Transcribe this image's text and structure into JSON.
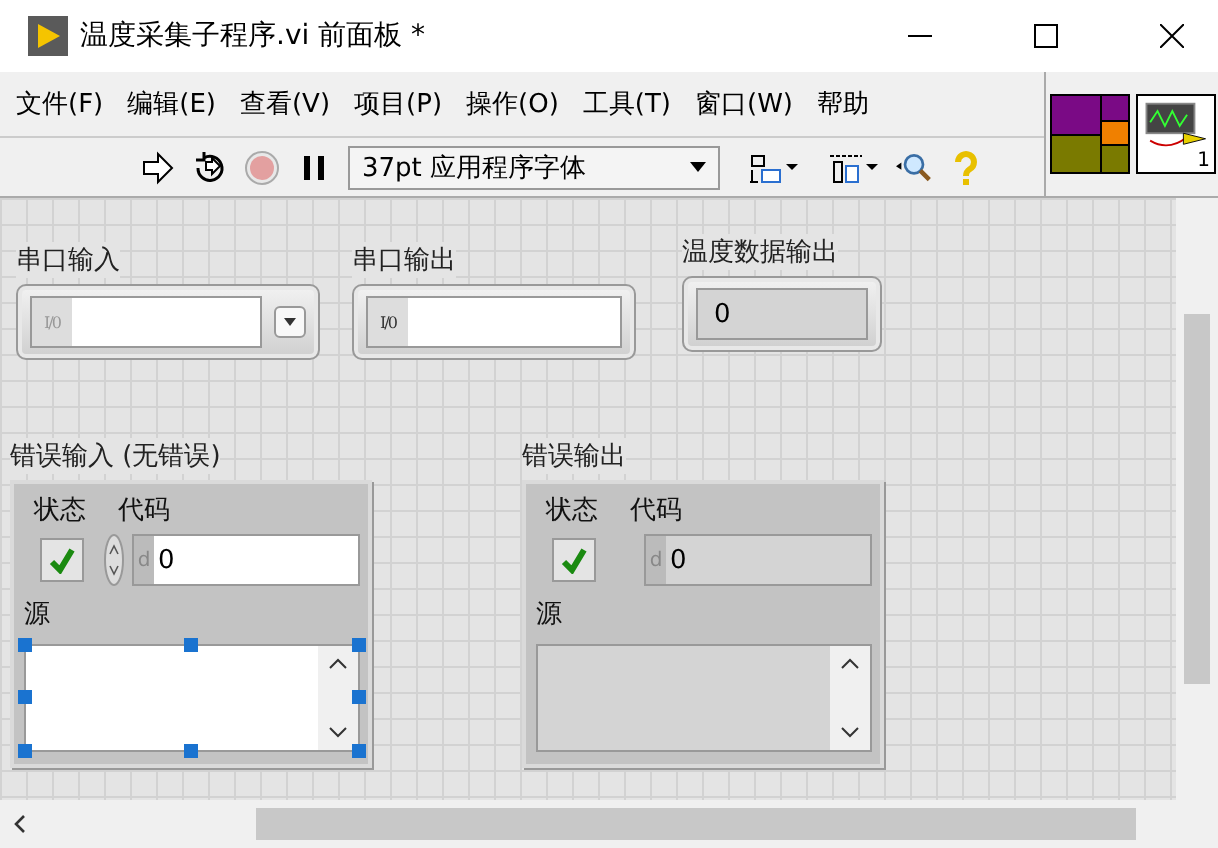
{
  "window": {
    "title": "温度采集子程序.vi 前面板 *"
  },
  "menu": [
    "文件(F)",
    "编辑(E)",
    "查看(V)",
    "项目(P)",
    "操作(O)",
    "工具(T)",
    "窗口(W)",
    "帮助"
  ],
  "toolbar": {
    "font_select": "37pt 应用程序字体"
  },
  "connector": {
    "terminal_number": "1"
  },
  "fields": [
    {
      "kind": "visa",
      "label": "串口输入",
      "prefix": "I/0",
      "dropdown": true,
      "disabled": true
    },
    {
      "kind": "visa",
      "label": "串口输出",
      "prefix": "I/0",
      "dropdown": false,
      "disabled": false
    },
    {
      "kind": "indicator",
      "label": "温度数据输出",
      "value": "0"
    }
  ],
  "clusters": [
    {
      "kind": "control",
      "label": "错误输入 (无错误)",
      "status_label": "状态",
      "status": true,
      "code_label": "代码",
      "radix": "d",
      "code": "0",
      "source_label": "源",
      "selected": true
    },
    {
      "kind": "indicator",
      "label": "错误输出",
      "status_label": "状态",
      "status": true,
      "code_label": "代码",
      "radix": "d",
      "code": "0",
      "source_label": "源",
      "selected": false
    }
  ]
}
